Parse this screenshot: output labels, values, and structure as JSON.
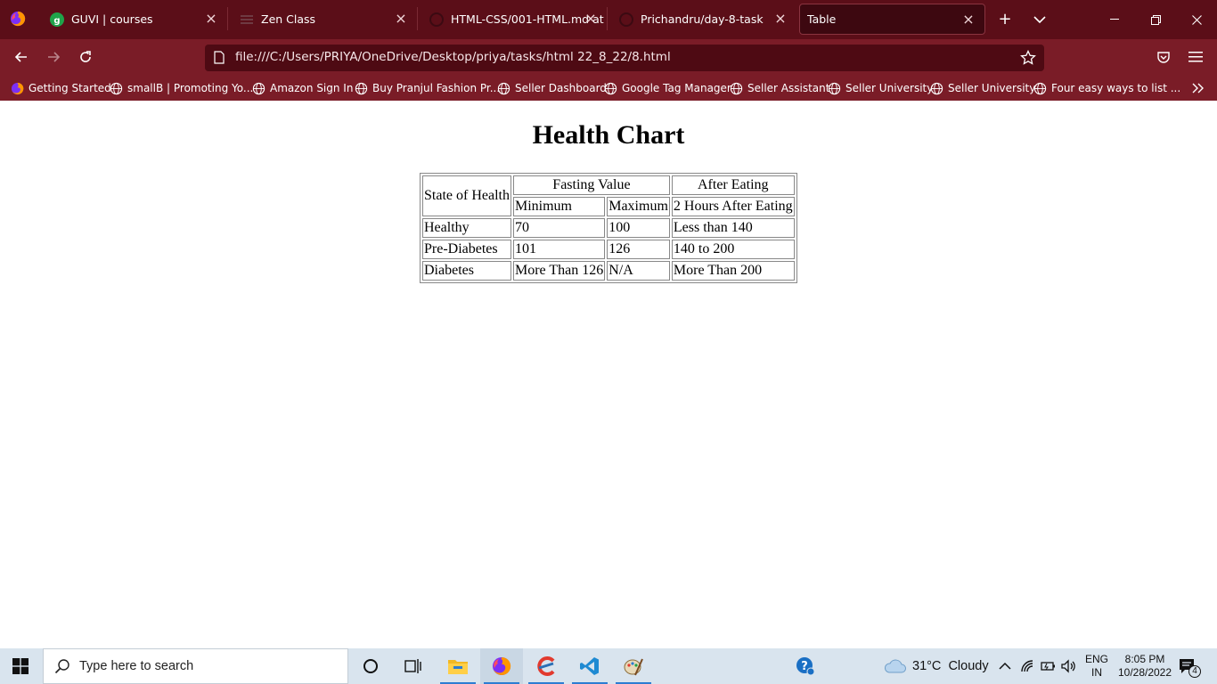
{
  "browser": {
    "tabs": [
      {
        "title": "GUVI | courses",
        "icon": "guvi-icon",
        "active": false
      },
      {
        "title": "Zen Class",
        "icon": "zen-class-icon",
        "active": false
      },
      {
        "title": "HTML-CSS/001-HTML.md at",
        "icon": "github-icon",
        "active": false
      },
      {
        "title": "Prichandru/day-8-task",
        "icon": "github-icon",
        "active": false
      },
      {
        "title": "Table",
        "icon": "none",
        "active": true
      }
    ],
    "url": "file:///C:/Users/PRIYA/OneDrive/Desktop/priya/tasks/html 22_8_22/8.html",
    "bookmarks": [
      "Getting Started",
      "smallB | Promoting Yo...",
      "Amazon Sign In",
      "Buy Pranjul Fashion Pr...",
      "Seller Dashboard",
      "Google Tag Manager",
      "Seller Assistant",
      "Seller University",
      "Seller University",
      "Four easy ways to list ..."
    ],
    "accent": "#5b0e18"
  },
  "page": {
    "title": "Health Chart",
    "table": {
      "header": {
        "state": "State of Health",
        "fasting": "Fasting Value",
        "after": "After Eating",
        "min": "Minimum",
        "max": "Maximum",
        "after_sub": "2 Hours After Eating"
      },
      "rows": [
        [
          "Healthy",
          "70",
          "100",
          "Less than 140"
        ],
        [
          "Pre-Diabetes",
          "101",
          "126",
          "140 to 200"
        ],
        [
          "Diabetes",
          "More Than 126",
          "N/A",
          "More Than 200"
        ]
      ]
    }
  },
  "taskbar": {
    "search_placeholder": "Type here to search",
    "weather": "31°C  Cloudy",
    "lang_top": "ENG",
    "lang_bottom": "IN",
    "time": "8:05 PM",
    "date": "10/28/2022",
    "notifications": "4"
  }
}
